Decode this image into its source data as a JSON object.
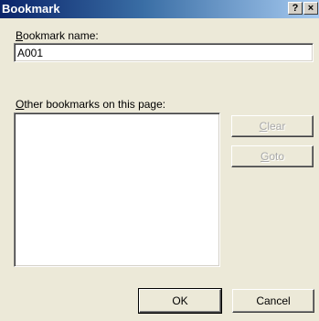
{
  "window": {
    "title": "Bookmark",
    "help_glyph": "?",
    "close_glyph": "×"
  },
  "form": {
    "name_label_accel": "B",
    "name_label_rest": "ookmark name:",
    "name_value": "A001",
    "others_label_accel": "O",
    "others_label_rest": "ther bookmarks on this page:",
    "others_items": []
  },
  "buttons": {
    "clear_accel": "C",
    "clear_rest": "lear",
    "goto_accel": "G",
    "goto_rest": "oto",
    "ok": "OK",
    "cancel": "Cancel"
  },
  "colors": {
    "title_start": "#0a246a",
    "title_end": "#a6caf0",
    "dialog_bg": "#ece9d8"
  }
}
